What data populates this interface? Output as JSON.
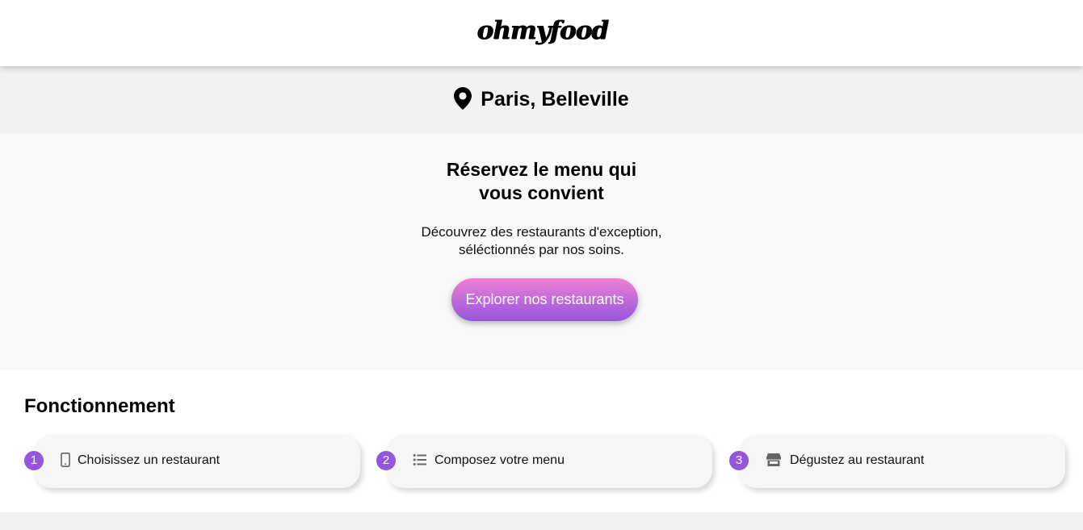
{
  "header": {
    "logo": "ohmyfood"
  },
  "location": {
    "icon": "map-marker-icon",
    "label": "Paris, Belleville"
  },
  "hero": {
    "title_line1": "Réservez le menu qui",
    "title_line2": "vous convient",
    "subtitle_line1": "Découvrez des restaurants d'exception,",
    "subtitle_line2": "séléctionnés par nos soins.",
    "cta_label": "Explorer nos restaurants"
  },
  "how": {
    "title": "Fonctionnement",
    "steps": [
      {
        "number": "1",
        "icon": "mobile-phone-icon",
        "label": "Choisissez un restaurant"
      },
      {
        "number": "2",
        "icon": "list-icon",
        "label": "Composez votre menu"
      },
      {
        "number": "3",
        "icon": "store-icon",
        "label": "Dégustez au restaurant"
      }
    ]
  },
  "colors": {
    "accent": "#9356dc",
    "cta_gradient_top": "#f07fd6",
    "cta_gradient_bottom": "#9356dc",
    "location_bg": "#f2f2f2",
    "hero_bg": "#f9f9f9"
  }
}
